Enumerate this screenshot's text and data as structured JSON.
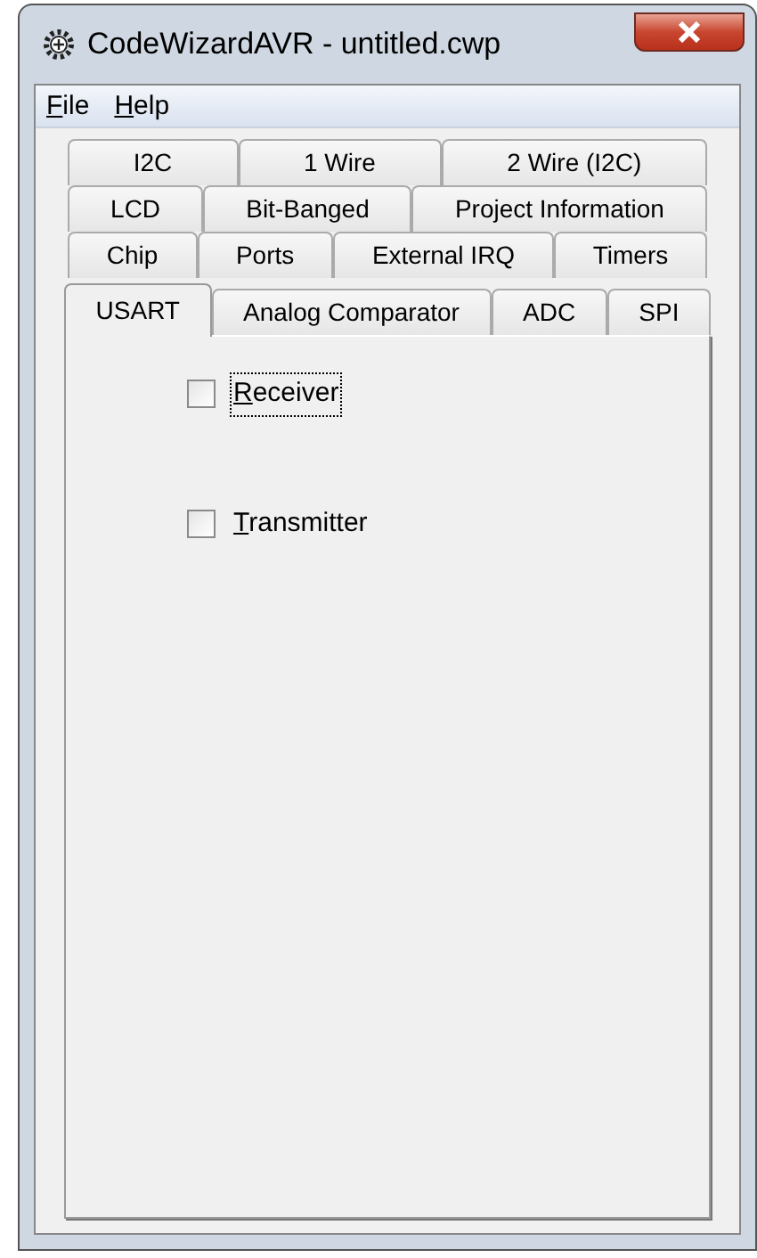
{
  "window": {
    "title": "CodeWizardAVR - untitled.cwp"
  },
  "menu": [
    {
      "label": "File"
    },
    {
      "label": "Help"
    }
  ],
  "tab_rows": [
    [
      {
        "label": "I2C",
        "selected": false
      },
      {
        "label": "1 Wire",
        "selected": false
      },
      {
        "label": "2 Wire (I2C)",
        "selected": false
      }
    ],
    [
      {
        "label": "LCD",
        "selected": false
      },
      {
        "label": "Bit-Banged",
        "selected": false
      },
      {
        "label": "Project Information",
        "selected": false
      }
    ],
    [
      {
        "label": "Chip",
        "selected": false
      },
      {
        "label": "Ports",
        "selected": false
      },
      {
        "label": "External IRQ",
        "selected": false
      },
      {
        "label": "Timers",
        "selected": false
      }
    ],
    [
      {
        "label": "USART",
        "selected": true
      },
      {
        "label": "Analog Comparator",
        "selected": false
      },
      {
        "label": "ADC",
        "selected": false
      },
      {
        "label": "SPI",
        "selected": false
      }
    ]
  ],
  "options": [
    {
      "label": "Receiver",
      "checked": false,
      "focused": true
    },
    {
      "label": "Transmitter",
      "checked": false,
      "focused": false
    }
  ]
}
